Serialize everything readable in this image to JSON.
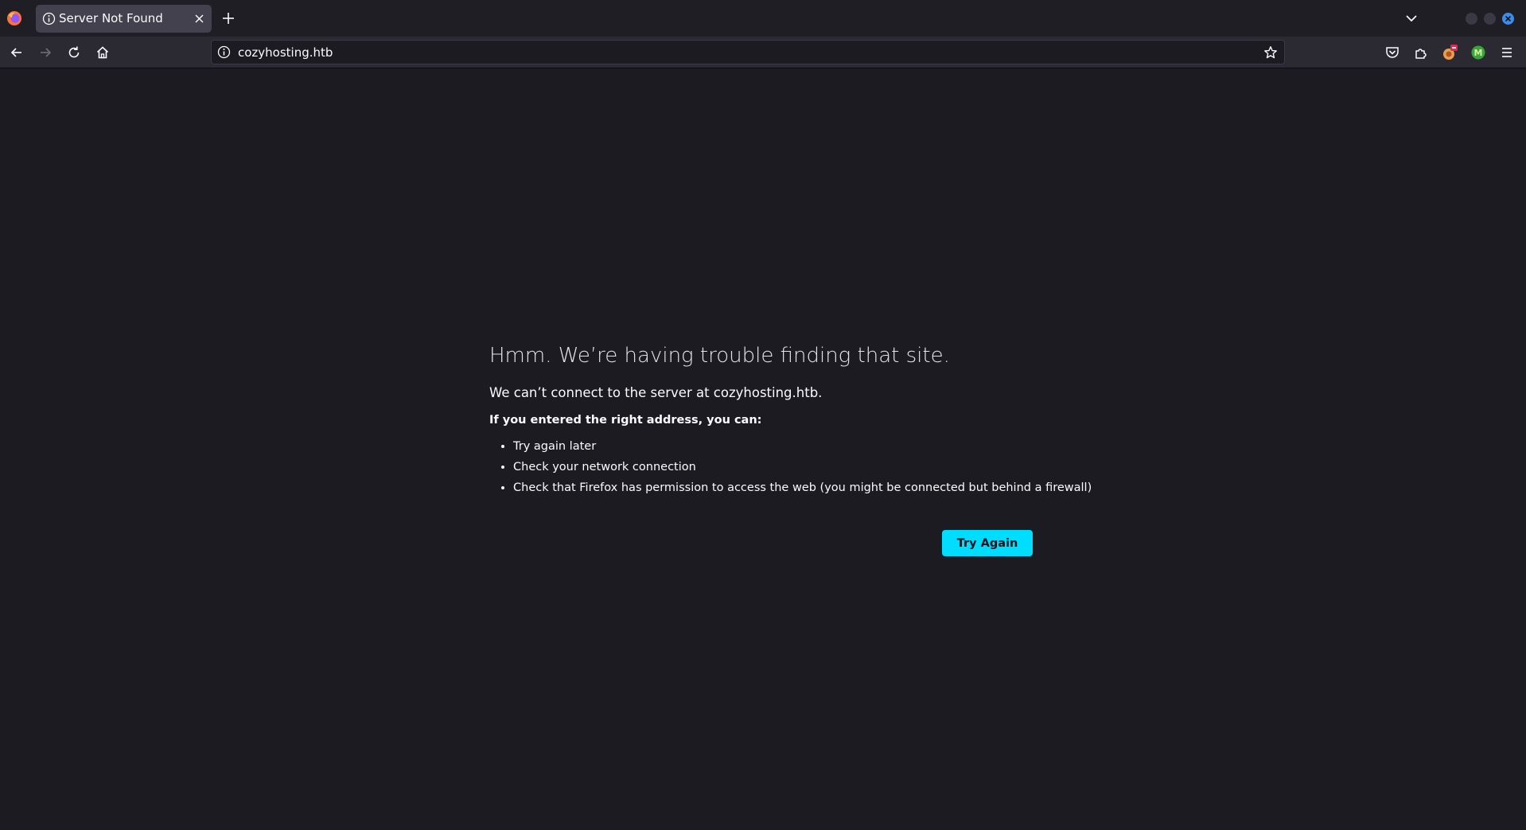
{
  "tabs": [
    {
      "title": "Server Not Found",
      "active": true
    }
  ],
  "urlbar": {
    "url": "cozyhosting.htb"
  },
  "icons": {
    "browser_logo": "firefox-logo-icon",
    "tab_info": "info-icon",
    "tab_close": "close-icon",
    "new_tab": "plus-icon",
    "tab_list": "chevron-down-icon",
    "back": "arrow-left-icon",
    "forward": "arrow-right-icon",
    "reload": "reload-icon",
    "home": "home-icon",
    "bookmark": "star-icon",
    "pocket": "pocket-icon",
    "extensions": "puzzle-icon",
    "extension_1": "extension-badge-icon",
    "extension_2": "extension-green-icon",
    "menu": "hamburger-menu-icon"
  },
  "colors": {
    "window_close": "#3d8de8",
    "accent_button": "#00ddff",
    "page_background": "#1c1b22"
  },
  "error": {
    "title": "Hmm. We’re having trouble finding that site.",
    "description": "We can’t connect to the server at cozyhosting.htb.",
    "subheading": "If you entered the right address, you can:",
    "suggestions": [
      "Try again later",
      "Check your network connection",
      "Check that Firefox has permission to access the web (you might be connected but behind a firewall)"
    ],
    "button_label": "Try Again"
  }
}
